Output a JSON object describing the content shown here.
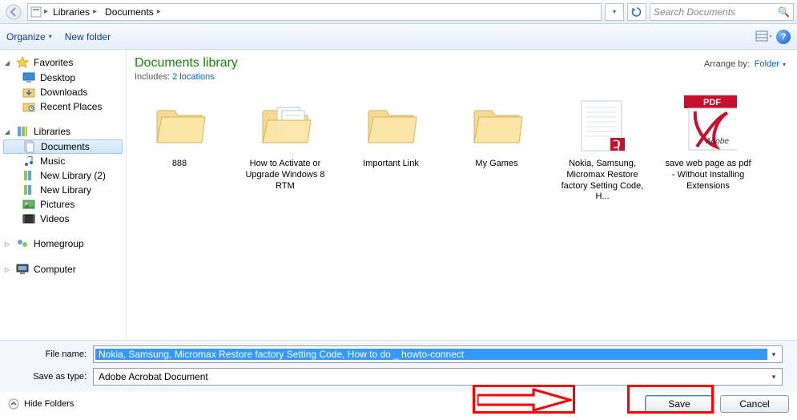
{
  "breadcrumb": {
    "segments": [
      "Libraries",
      "Documents"
    ]
  },
  "search": {
    "placeholder": "Search Documents"
  },
  "toolbar": {
    "organize": "Organize",
    "new_folder": "New folder"
  },
  "sidebar": {
    "favorites": {
      "label": "Favorites",
      "items": [
        "Desktop",
        "Downloads",
        "Recent Places"
      ]
    },
    "libraries": {
      "label": "Libraries",
      "items": [
        "Documents",
        "Music",
        "New Library (2)",
        "New Library",
        "Pictures",
        "Videos"
      ],
      "selected": "Documents"
    },
    "homegroup": {
      "label": "Homegroup"
    },
    "computer": {
      "label": "Computer"
    }
  },
  "library": {
    "title": "Documents library",
    "includes_label": "Includes:",
    "locations": "2 locations",
    "arrange_label": "Arrange by:",
    "arrange_value": "Folder"
  },
  "items": [
    {
      "type": "folder",
      "label": "888"
    },
    {
      "type": "folder-docs",
      "label": "How to Activate or Upgrade Windows 8 RTM"
    },
    {
      "type": "folder",
      "label": "Important Link"
    },
    {
      "type": "folder",
      "label": "My Games"
    },
    {
      "type": "pdf-doc",
      "label": "Nokia, Samsung, Micromax Restore factory Setting Code, H..."
    },
    {
      "type": "pdf-icon",
      "label": "save web page as pdf - Without Installing Extensions"
    }
  ],
  "footer": {
    "filename_label": "File name:",
    "filename_value": "Nokia, Samsung, Micromax Restore factory Setting Code, How to do _ howto-connect",
    "saveas_label": "Save as type:",
    "saveas_value": "Adobe Acrobat Document",
    "hide_folders": "Hide Folders",
    "save": "Save",
    "cancel": "Cancel"
  }
}
